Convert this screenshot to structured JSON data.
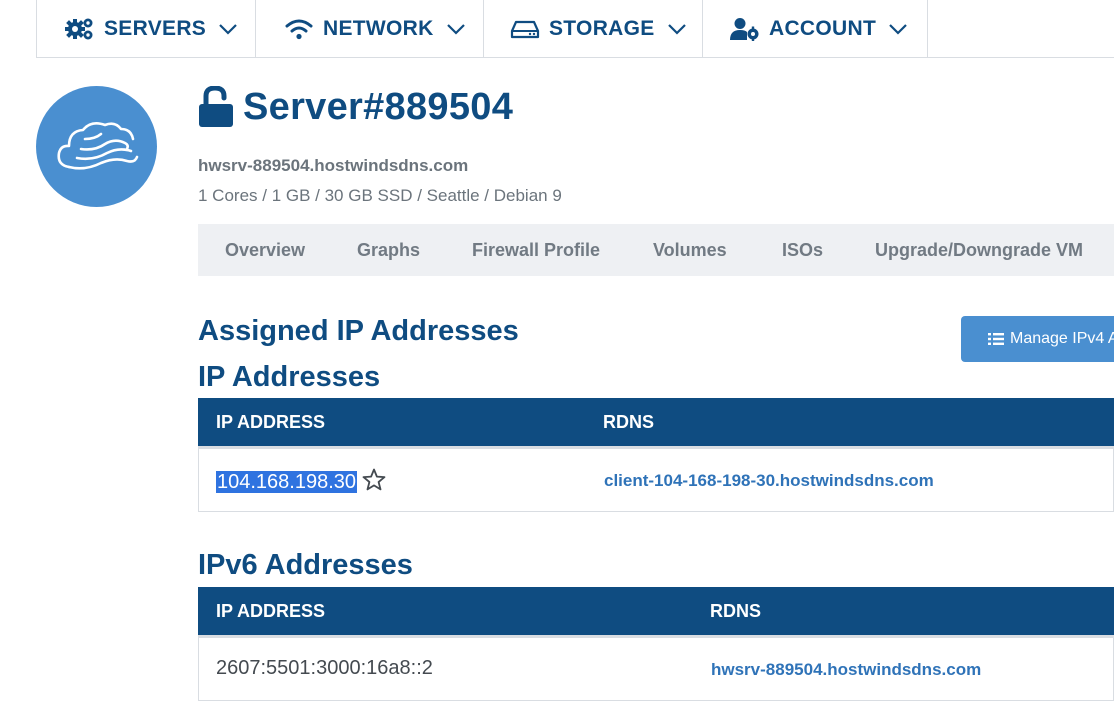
{
  "nav": {
    "items": [
      {
        "label": "SERVERS",
        "icon": "cogs-icon"
      },
      {
        "label": "NETWORK",
        "icon": "wifi-icon"
      },
      {
        "label": "STORAGE",
        "icon": "hdd-icon"
      },
      {
        "label": "ACCOUNT",
        "icon": "user-cog-icon"
      }
    ]
  },
  "server": {
    "title": "Server#889504",
    "hostname": "hwsrv-889504.hostwindsdns.com",
    "specs": "1 Cores / 1 GB / 30 GB SSD / Seattle / Debian 9"
  },
  "tabs": [
    "Overview",
    "Graphs",
    "Firewall Profile",
    "Volumes",
    "ISOs",
    "Upgrade/Downgrade VM"
  ],
  "assigned": {
    "title": "Assigned IP Addresses",
    "manage_button": "Manage IPv4 A"
  },
  "ipv4": {
    "title": "IP Addresses",
    "columns": [
      "IP ADDRESS",
      "RDNS"
    ],
    "rows": [
      {
        "ip": "104.168.198.30",
        "rdns": "client-104-168-198-30.hostwindsdns.com"
      }
    ]
  },
  "ipv6": {
    "title": "IPv6 Addresses",
    "columns": [
      "IP ADDRESS",
      "RDNS"
    ],
    "rows": [
      {
        "ip": "2607:5501:3000:16a8::2",
        "rdns": "hwsrv-889504.hostwindsdns.com"
      }
    ]
  },
  "colors": {
    "brand_navy": "#0f4c81",
    "accent_blue": "#4a8fd0",
    "link_blue": "#2f73b8",
    "tab_bg": "#eef0f3"
  }
}
